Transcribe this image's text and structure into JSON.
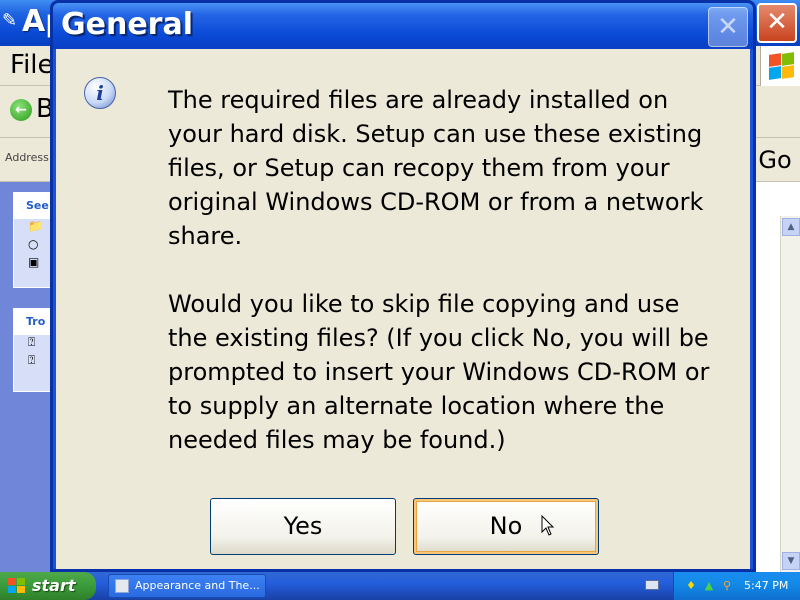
{
  "background_window": {
    "title": "Appearance and Themes",
    "title_visible": "Ap",
    "menu_file": "File",
    "back_label": "B",
    "address_label": "Address",
    "go_label": "Go",
    "taskpane": {
      "box1_head": "See",
      "box2_head": "Tro"
    }
  },
  "dialog": {
    "title": "General",
    "message_1": "The required files are already installed on\nyour hard disk. Setup can use these existing\nfiles, or Setup can recopy them from your\noriginal Windows CD-ROM or from a network\nshare.",
    "message_2": "Would you like to skip file copying and use\nthe existing files? (If you click No, you will be\nprompted to insert your Windows CD-ROM or\nto supply an alternate location where the\nneeded files may be found.)",
    "yes_label": "Yes",
    "no_label": "No",
    "icon": "info-icon"
  },
  "taskbar": {
    "start_label": "start",
    "task_item_label": "Appearance and The...",
    "clock": "5:47 PM"
  },
  "colors": {
    "titlebar_blue": "#0a4ad6",
    "dialog_face": "#ece9d8",
    "start_green": "#3c9d3c",
    "tray_blue": "#138be8",
    "focus_orange": "#e9a443"
  }
}
